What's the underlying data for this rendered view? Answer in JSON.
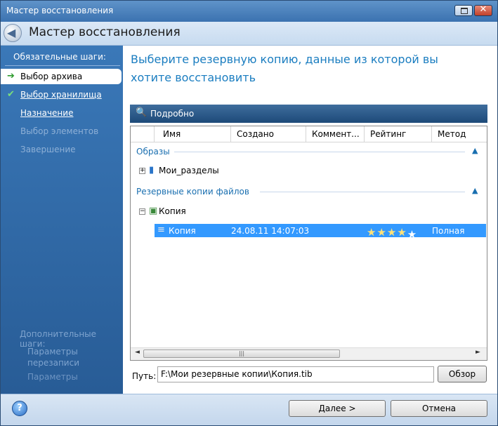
{
  "window": {
    "title": "Мастер восстановления"
  },
  "header": {
    "title": "Мастер восстановления"
  },
  "sidebar": {
    "required_heading": "Обязательные шаги:",
    "items": [
      {
        "label": "Выбор архива",
        "state": "selected",
        "icon": "arrow-right-icon"
      },
      {
        "label": "Выбор хранилища",
        "state": "done",
        "icon": "checkmark-icon"
      },
      {
        "label": "Назначение",
        "state": "link"
      },
      {
        "label": "Выбор элементов",
        "state": "disabled"
      },
      {
        "label": "Завершение",
        "state": "disabled"
      }
    ],
    "optional_heading": "Дополнительные шаги:",
    "optional_items": [
      {
        "label": "Параметры перезаписи"
      },
      {
        "label": "Параметры"
      }
    ]
  },
  "main": {
    "title": "Выберите резервную копию, данные из которой вы хотите восстановить",
    "panel_title": "Подробно",
    "columns": [
      "Имя",
      "Создано",
      "Коммент...",
      "Рейтинг",
      "Метод"
    ],
    "groups": [
      {
        "label": "Образы",
        "items": [
          {
            "name": "Мои_разделы",
            "expanded": false
          }
        ]
      },
      {
        "label": "Резервные копии файлов",
        "items": [
          {
            "name": "Копия",
            "expanded": true,
            "children": [
              {
                "name": "Копия",
                "created": "24.08.11 14:07:03",
                "rating": 4,
                "method": "Полная резе"
              }
            ]
          }
        ]
      }
    ],
    "path_label": "Путь:",
    "path_value": "F:\\Мои резервные копии\\Копия.tib",
    "browse_label": "Обзор"
  },
  "footer": {
    "help_label": "?",
    "next_label": "Далее >",
    "cancel_label": "Отмена"
  },
  "colors": {
    "sidebar_bg": "#3a78b8",
    "title_text": "#1a7dc0",
    "selection": "#3399ff"
  }
}
